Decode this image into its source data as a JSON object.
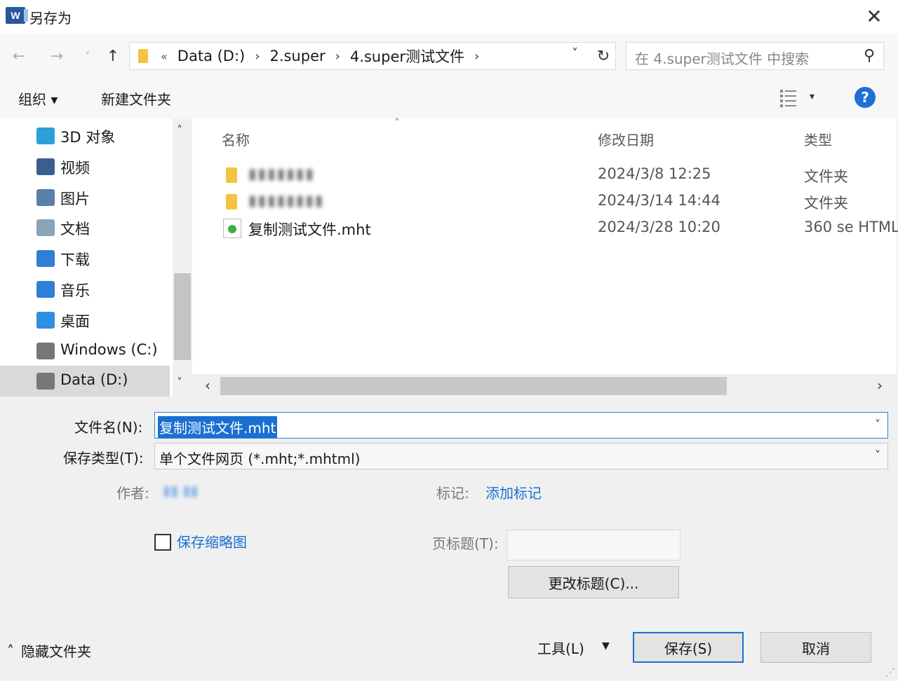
{
  "window": {
    "app_icon": "word-icon",
    "app_icon_letter": "W",
    "title": "另存为",
    "close": "✕"
  },
  "address": {
    "back": "←",
    "forward": "→",
    "recent": "˅",
    "up": "↑",
    "overflow": "«",
    "crumbs": [
      "Data (D:)",
      "2.super",
      "4.super测试文件"
    ],
    "separator": "›",
    "dropdown": "˅",
    "refresh": "↻"
  },
  "search": {
    "placeholder": "在 4.super测试文件 中搜索"
  },
  "toolbar": {
    "organize": "组织 ▾",
    "new_folder": "新建文件夹",
    "view_dropdown": "▾",
    "help": "?"
  },
  "nav": {
    "items": [
      {
        "label": "3D 对象",
        "icon": "3d-objects-icon",
        "color": "#2aa0d6"
      },
      {
        "label": "视频",
        "icon": "videos-icon",
        "color": "#3a5f8f"
      },
      {
        "label": "图片",
        "icon": "pictures-icon",
        "color": "#5a7fa8"
      },
      {
        "label": "文档",
        "icon": "documents-icon",
        "color": "#8aa4b8"
      },
      {
        "label": "下载",
        "icon": "downloads-icon",
        "color": "#2f7fd7"
      },
      {
        "label": "音乐",
        "icon": "music-icon",
        "color": "#2f7fd7"
      },
      {
        "label": "桌面",
        "icon": "desktop-icon",
        "color": "#2f8fe0"
      },
      {
        "label": "Windows (C:)",
        "icon": "drive-c-icon",
        "color": "#777777"
      },
      {
        "label": "Data (D:)",
        "icon": "drive-d-icon",
        "color": "#777777"
      }
    ],
    "scroll_up": "˄",
    "scroll_down": "˅"
  },
  "columns": {
    "name": "名称",
    "modified": "修改日期",
    "type": "类型",
    "sort_caret": "˄"
  },
  "files": [
    {
      "name": "▮▮▮▮▮▮▮",
      "modified": "2024/3/8 12:25",
      "type": "文件夹",
      "kind": "folder",
      "blurred": true
    },
    {
      "name": "▮▮▮▮▮▮▮▮",
      "modified": "2024/3/14 14:44",
      "type": "文件夹",
      "kind": "folder",
      "blurred": true
    },
    {
      "name": "复制测试文件.mht",
      "modified": "2024/3/28 10:20",
      "type": "360 se HTML",
      "kind": "mht",
      "blurred": false
    }
  ],
  "hscroll": {
    "left": "‹",
    "right": "›"
  },
  "form": {
    "filename_label": "文件名(N):",
    "filename_value": "复制测试文件.mht",
    "filetype_label": "保存类型(T):",
    "filetype_value": "单个文件网页 (*.mht;*.mhtml)",
    "combo_chevron": "˅",
    "author_label": "作者:",
    "author_value": "▮▮ ▮▮",
    "tags_label": "标记:",
    "tags_link": "添加标记",
    "thumbnail_label": "保存缩略图",
    "thumbnail_checked": false,
    "page_title_label": "页标题(T):",
    "page_title_value": "",
    "change_title": "更改标题(C)..."
  },
  "footer": {
    "hide_folders": "隐藏文件夹",
    "hide_caret": "˄",
    "tools": "工具(L)",
    "tools_drop": "▼",
    "save": "保存(S)",
    "cancel": "取消"
  }
}
